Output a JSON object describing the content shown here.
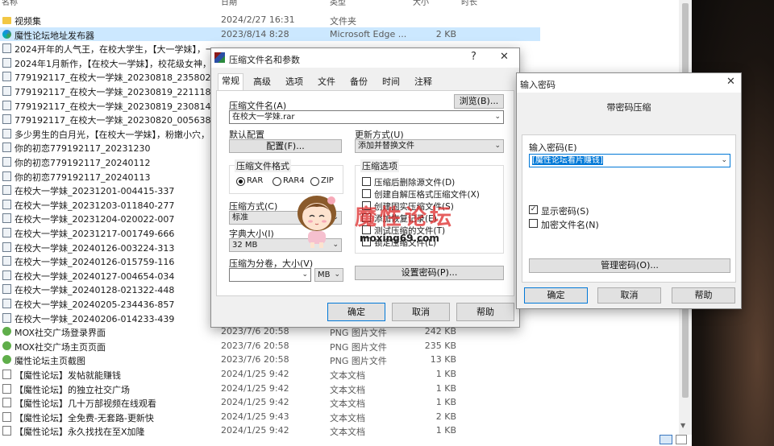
{
  "explorer": {
    "headers": {
      "name": "名称",
      "date": "日期",
      "type": "类型",
      "size": "大小",
      "duration": "时长"
    },
    "files": [
      {
        "icon": "folder",
        "name": "视频集",
        "date": "2024/2/27 16:31",
        "type": "文件夹",
        "size": ""
      },
      {
        "icon": "edge",
        "name": "魔性论坛地址发布器",
        "date": "2023/8/14 8:28",
        "type": "Microsoft Edge ...",
        "size": "2 KB",
        "selected": true
      },
      {
        "icon": "video",
        "name": "2024开年的人气王，在校大学生，【大一学妹】，一...",
        "date": "",
        "type": "",
        "size": ""
      },
      {
        "icon": "video",
        "name": "2024年1月新作，【在校大一学妹】，校花级女神，...",
        "date": "",
        "type": "",
        "size": ""
      },
      {
        "icon": "video",
        "name": "779192117_在校大一学妹_20230818_235802",
        "date": "",
        "type": "",
        "size": ""
      },
      {
        "icon": "video",
        "name": "779192117_在校大一学妹_20230819_221118",
        "date": "",
        "type": "",
        "size": ""
      },
      {
        "icon": "video",
        "name": "779192117_在校大一学妹_20230819_230814",
        "date": "",
        "type": "",
        "size": ""
      },
      {
        "icon": "video",
        "name": "779192117_在校大一学妹_20230820_005638",
        "date": "",
        "type": "",
        "size": ""
      },
      {
        "icon": "video",
        "name": "多少男生的白月光，【在校大一学妹】，粉嫩小穴，...",
        "date": "",
        "type": "",
        "size": ""
      },
      {
        "icon": "video",
        "name": "你的初恋779192117_20231230",
        "date": "",
        "type": "",
        "size": ""
      },
      {
        "icon": "video",
        "name": "你的初恋779192117_20240112",
        "date": "",
        "type": "",
        "size": ""
      },
      {
        "icon": "video",
        "name": "你的初恋779192117_20240113",
        "date": "",
        "type": "",
        "size": ""
      },
      {
        "icon": "video",
        "name": "在校大一学妹_20231201-004415-337",
        "date": "",
        "type": "",
        "size": ""
      },
      {
        "icon": "video",
        "name": "在校大一学妹_20231203-011840-277",
        "date": "",
        "type": "",
        "size": ""
      },
      {
        "icon": "video",
        "name": "在校大一学妹_20231204-020022-007",
        "date": "",
        "type": "",
        "size": ""
      },
      {
        "icon": "video",
        "name": "在校大一学妹_20231217-001749-666",
        "date": "",
        "type": "",
        "size": ""
      },
      {
        "icon": "video",
        "name": "在校大一学妹_20240126-003224-313",
        "date": "",
        "type": "",
        "size": ""
      },
      {
        "icon": "video",
        "name": "在校大一学妹_20240126-015759-116",
        "date": "",
        "type": "",
        "size": ""
      },
      {
        "icon": "video",
        "name": "在校大一学妹_20240127-004654-034",
        "date": "",
        "type": "",
        "size": ""
      },
      {
        "icon": "video",
        "name": "在校大一学妹_20240128-021322-448",
        "date": "",
        "type": "",
        "size": ""
      },
      {
        "icon": "video",
        "name": "在校大一学妹_20240205-234436-857",
        "date": "",
        "type": "",
        "size": ""
      },
      {
        "icon": "video",
        "name": "在校大一学妹_20240206-014233-439",
        "date": "",
        "type": "",
        "size": ""
      },
      {
        "icon": "png",
        "name": "MOX社交广场登录界面",
        "date": "2023/7/6 20:58",
        "type": "PNG 图片文件",
        "size": "242 KB"
      },
      {
        "icon": "png",
        "name": "MOX社交广场主页页面",
        "date": "2023/7/6 20:58",
        "type": "PNG 图片文件",
        "size": "235 KB"
      },
      {
        "icon": "png",
        "name": "魔性论坛主页截图",
        "date": "2023/7/6 20:58",
        "type": "PNG 图片文件",
        "size": "13 KB"
      },
      {
        "icon": "txt",
        "name": "【魔性论坛】发帖就能赚钱",
        "date": "2024/1/25 9:42",
        "type": "文本文档",
        "size": "1 KB"
      },
      {
        "icon": "txt",
        "name": "【魔性论坛】的独立社交广场",
        "date": "2024/1/25 9:42",
        "type": "文本文档",
        "size": "1 KB"
      },
      {
        "icon": "txt",
        "name": "【魔性论坛】几十万部视频在线观看",
        "date": "2024/1/25 9:42",
        "type": "文本文档",
        "size": "1 KB"
      },
      {
        "icon": "txt",
        "name": "【魔性论坛】全免费-无套路-更新快",
        "date": "2024/1/25 9:43",
        "type": "文本文档",
        "size": "2 KB"
      },
      {
        "icon": "txt",
        "name": "【魔性论坛】永久找找在至X加隆",
        "date": "2024/1/25 9:42",
        "type": "文本文档",
        "size": "1 KB"
      }
    ]
  },
  "archive_dialog": {
    "title": "压缩文件名和参数",
    "help_glyph": "?",
    "close_glyph": "✕",
    "tabs": [
      "常规",
      "高级",
      "选项",
      "文件",
      "备份",
      "时间",
      "注释"
    ],
    "archive_name_label": "压缩文件名(A)",
    "browse_button": "浏览(B)...",
    "archive_name_value": "在校大一学妹.rar",
    "default_profile_label": "默认配置",
    "profile_button": "配置(F)...",
    "update_mode_label": "更新方式(U)",
    "update_mode_value": "添加并替换文件",
    "format_group": "压缩文件格式",
    "formats": [
      "RAR",
      "RAR4",
      "ZIP"
    ],
    "options_group": "压缩选项",
    "options": [
      {
        "label": "压缩后删除源文件(D)",
        "checked": false
      },
      {
        "label": "创建自解压格式压缩文件(X)",
        "checked": false
      },
      {
        "label": "创建固实压缩文件(S)",
        "checked": false
      },
      {
        "label": "添加恢复记录(E)",
        "checked": false
      },
      {
        "label": "测试压缩的文件(T)",
        "checked": false
      },
      {
        "label": "锁定压缩文件(L)",
        "checked": false
      }
    ],
    "method_label": "压缩方式(C)",
    "method_value": "标准",
    "dict_label": "字典大小(I)",
    "dict_value": "32 MB",
    "split_label": "压缩为分卷，大小(V)",
    "split_value": "",
    "split_unit": "MB",
    "set_password_button": "设置密码(P)...",
    "ok_button": "确定",
    "cancel_button": "取消",
    "help_button": "帮助"
  },
  "password_dialog": {
    "title": "输入密码",
    "close_glyph": "✕",
    "heading": "带密码压缩",
    "password_label": "输入密码(E)",
    "password_value": "[魔性论坛看片赚钱]",
    "show_password_label": "显示密码(S)",
    "show_password_checked": true,
    "encrypt_names_label": "加密文件名(N)",
    "encrypt_names_checked": false,
    "manage_button": "管理密码(O)...",
    "ok_button": "确定",
    "cancel_button": "取消",
    "help_button": "帮助"
  },
  "watermark": {
    "title": "魔性论坛",
    "url": "moxing69.com"
  },
  "colors": {
    "selection": "#cce8ff",
    "accent": "#0078d7",
    "watermark": "#dc2828"
  }
}
